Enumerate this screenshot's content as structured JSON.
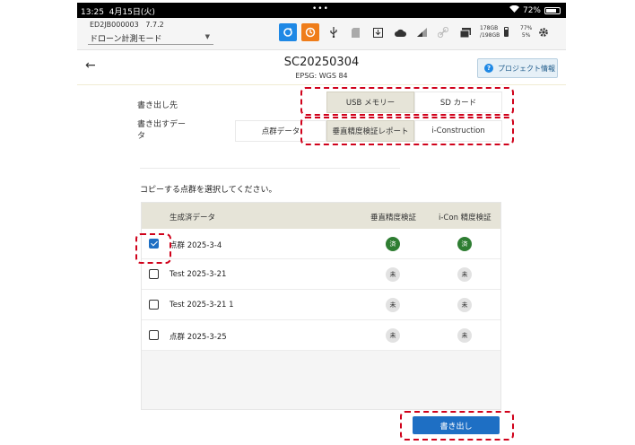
{
  "status_bar": {
    "time": "13:25",
    "date": "4月15日(火)",
    "dots": "•••",
    "battery": "72%"
  },
  "toolbar": {
    "device_id": "ED2JB000003",
    "version": "7.7.2",
    "mode": "ドローン計測モード",
    "storage_used": "178GB",
    "storage_total": "/198GB",
    "percent_top": "77%",
    "percent_bottom": "5%"
  },
  "header": {
    "title": "SC20250304",
    "subtitle": "EPSG: WGS 84",
    "project_info_label": "プロジェクト情報"
  },
  "export": {
    "destination_label": "書き出し先",
    "destination_options": [
      "USB メモリー",
      "SD カード"
    ],
    "destination_selected": "USB メモリー",
    "data_label_line1": "書き出すデー",
    "data_label_line2": "タ",
    "data_options": [
      "点群データ",
      "垂直精度検証レポート",
      "i-Construction"
    ],
    "data_selected": "垂直精度検証レポート"
  },
  "instruction": "コピーする点群を選択してください。",
  "table": {
    "headers": [
      "生成済データ",
      "垂直精度検証",
      "i-Con 精度検証"
    ],
    "rows": [
      {
        "name": "点群 2025-3-4",
        "checked": true,
        "vertical": "済",
        "icon": "済"
      },
      {
        "name": "Test 2025-3-21",
        "checked": false,
        "vertical": "未",
        "icon": "未"
      },
      {
        "name": "Test 2025-3-21 1",
        "checked": false,
        "vertical": "未",
        "icon": "未"
      },
      {
        "name": "点群 2025-3-25",
        "checked": false,
        "vertical": "未",
        "icon": "未"
      }
    ]
  },
  "export_button_label": "書き出し",
  "colors": {
    "accent": "#1e6fc4",
    "highlight": "#d0021b",
    "done": "#2e7d32",
    "selected_segment": "#e6e4d8"
  }
}
